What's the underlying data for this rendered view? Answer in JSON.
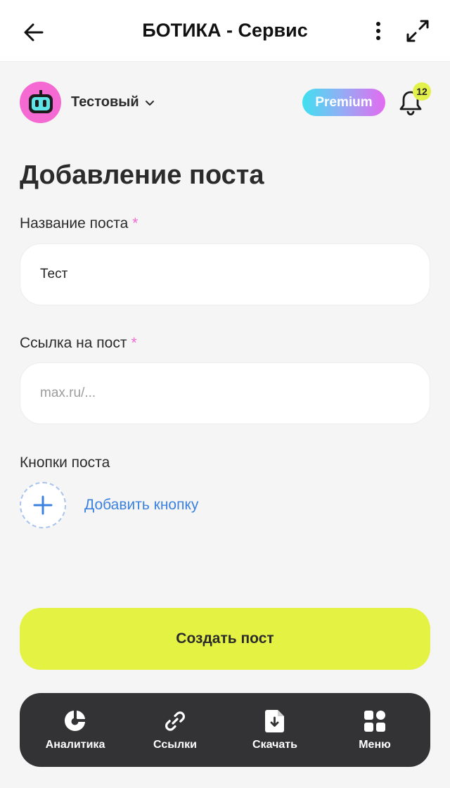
{
  "header": {
    "title": "БОТИКА - Сервис",
    "back_icon": "arrow-left-icon",
    "more_icon": "more-vertical-icon",
    "expand_icon": "expand-icon"
  },
  "profile": {
    "name": "Тестовый",
    "avatar_icon": "robot-icon",
    "avatar_color": "#f46ad2"
  },
  "premium": {
    "label": "Premium"
  },
  "notifications": {
    "count": "12",
    "icon": "bell-icon"
  },
  "page": {
    "title": "Добавление поста"
  },
  "form": {
    "post_name": {
      "label": "Название поста",
      "required_mark": "*",
      "value": "Тест"
    },
    "post_link": {
      "label": "Ссылка на пост",
      "required_mark": "*",
      "value": "",
      "placeholder": "max.ru/..."
    },
    "buttons": {
      "label": "Кнопки поста",
      "add_label": "Добавить кнопку"
    }
  },
  "actions": {
    "create": "Создать пост"
  },
  "bottom_nav": {
    "items": [
      {
        "label": "Аналитика",
        "icon": "pie-chart-icon"
      },
      {
        "label": "Ссылки",
        "icon": "link-icon"
      },
      {
        "label": "Скачать",
        "icon": "download-file-icon"
      },
      {
        "label": "Меню",
        "icon": "grid-menu-icon"
      }
    ]
  },
  "colors": {
    "accent_lime": "#e3f243",
    "link_blue": "#3b82e0",
    "required_pink": "#f26bd0",
    "nav_bg": "#333234"
  }
}
